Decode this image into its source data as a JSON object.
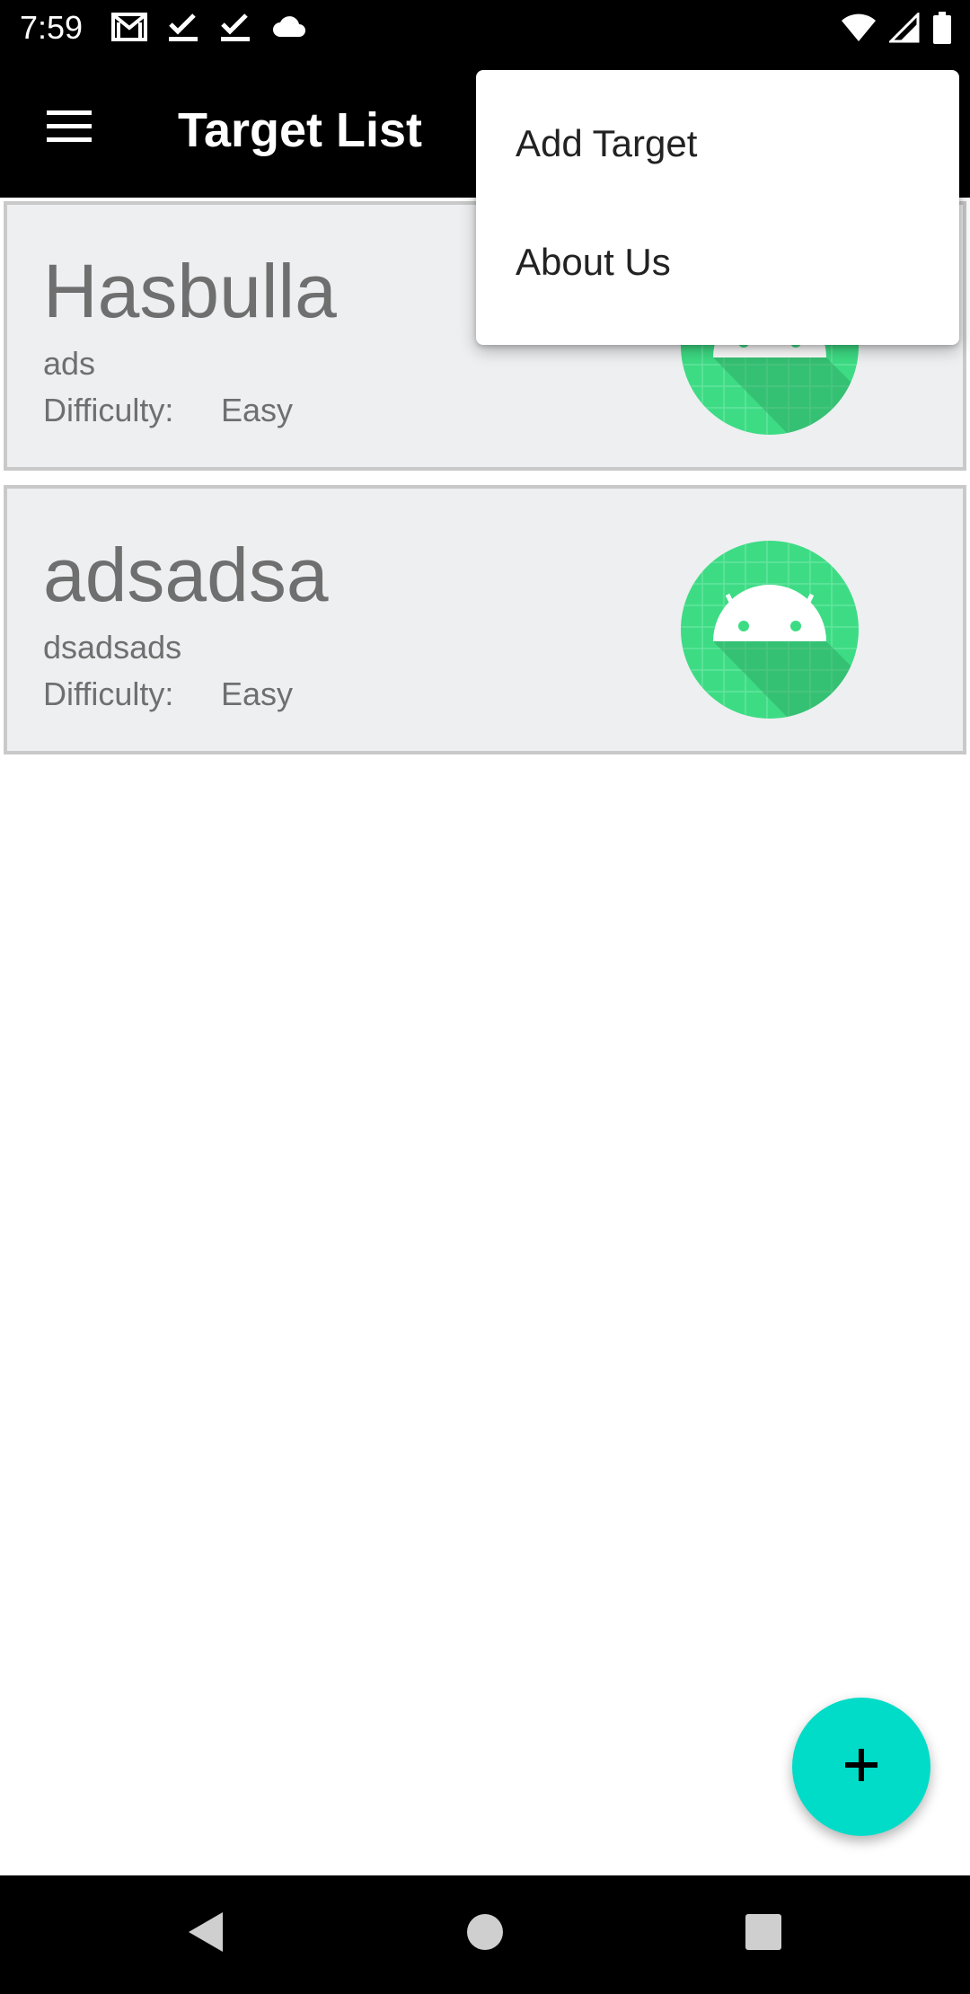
{
  "status_bar": {
    "time": "7:59",
    "left_icons": [
      "gmail-icon",
      "check-icon",
      "check-icon",
      "cloud-icon"
    ],
    "right_icons": [
      "wifi-icon",
      "signal-icon",
      "battery-icon"
    ]
  },
  "app_bar": {
    "title": "Target List",
    "menu_icon": "hamburger-menu-icon"
  },
  "targets": [
    {
      "name": "Hasbulla",
      "description": "ads",
      "difficulty_label": "Difficulty:",
      "difficulty": "Easy",
      "avatar_icon": "android-avatar-icon"
    },
    {
      "name": "adsadsa",
      "description": "dsadsads",
      "difficulty_label": "Difficulty:",
      "difficulty": "Easy",
      "avatar_icon": "android-avatar-icon"
    }
  ],
  "popup_menu": {
    "items": [
      {
        "label": "Add Target"
      },
      {
        "label": "About Us"
      }
    ]
  },
  "fab": {
    "icon": "plus-icon",
    "color": "#00dcc7"
  },
  "nav_bar": {
    "icons": [
      "back-icon",
      "home-icon",
      "recents-icon"
    ]
  },
  "colors": {
    "accent": "#00dcc7",
    "avatar_green": "#3ddc84",
    "card_bg": "#eeeff1",
    "bar_bg": "#000000"
  }
}
